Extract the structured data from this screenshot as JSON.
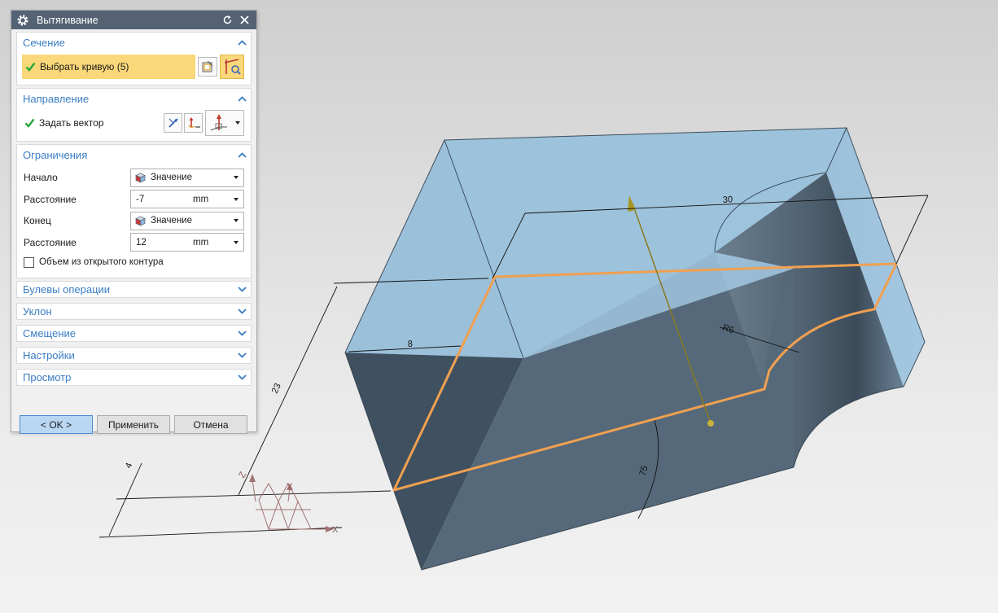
{
  "dialog": {
    "title": "Вытягивание",
    "sections": {
      "section": {
        "title": "Сечение",
        "select_curve_label": "Выбрать кривую (5)"
      },
      "direction": {
        "title": "Направление",
        "vector_label": "Задать вектор"
      },
      "limits": {
        "title": "Ограничения",
        "start_label": "Начало",
        "start_option": "Значение",
        "start_distance_label": "Расстояние",
        "start_distance_value": "-7",
        "start_unit": "mm",
        "end_label": "Конец",
        "end_option": "Значение",
        "end_distance_label": "Расстояние",
        "end_distance_value": "12",
        "end_unit": "mm",
        "open_profile_label": "Объем из открытого контура",
        "open_profile_checked": false
      },
      "boolean": {
        "title": "Булевы операции"
      },
      "draft": {
        "title": "Уклон"
      },
      "offset": {
        "title": "Смещение"
      },
      "settings": {
        "title": "Настройки"
      },
      "preview": {
        "title": "Просмотр"
      }
    },
    "buttons": {
      "ok": "< OK >",
      "apply": "Применить",
      "cancel": "Отмена"
    }
  },
  "viewport": {
    "dimensions": {
      "width_top": "30",
      "height_left": "23",
      "depth_front": "8",
      "radius": "R6",
      "small_offset": "4",
      "angle": "75"
    },
    "axes": {
      "x": "X",
      "y": "Y",
      "z": "Z"
    }
  },
  "colors": {
    "title_bar": "#546274",
    "section_header": "#3a7dc4",
    "selection_highlight": "#fad879",
    "sketch_curve": "#f0a050",
    "body_dark": "#3f5060",
    "body_light": "#9fc6e0",
    "vector": "#8a7a20"
  }
}
